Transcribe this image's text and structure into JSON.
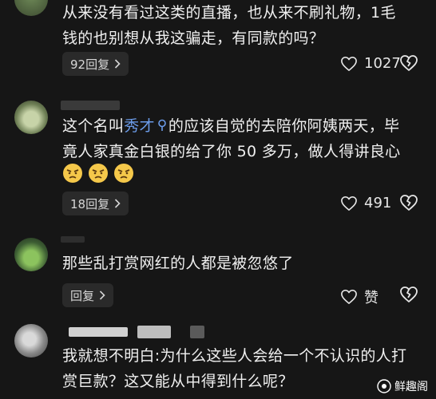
{
  "comments": [
    {
      "lines": [
        "从来没有看过这类的直播，也从来不刷礼物，1毛",
        "钱的也别想从我这骗走，有同款的吗？"
      ],
      "replies_label": "92回复",
      "like_count": "1027"
    },
    {
      "text_before_link": "这个名叫",
      "link_text": "秀才",
      "text_after_link": "的应该自觉的去陪你阿姨两天，毕",
      "line2": "竟人家真金白银的给了你 50 多万，做人得讲良心",
      "emojis": [
        "angry-face-emoji",
        "angry-face-emoji",
        "angry-face-emoji"
      ],
      "replies_label": "18回复",
      "like_count": "491"
    },
    {
      "text": "那些乱打赏网红的人都是被忽悠了",
      "replies_label": "回复",
      "like_label": "赞"
    },
    {
      "lines": [
        "我就想不明白:为什么这些人会给一个不认识的人打",
        "赏巨款？这又能从中得到什么呢？"
      ]
    }
  ],
  "watermark": {
    "text": "鲜趣阁"
  },
  "icons": {
    "heart": "heart-outline-icon",
    "broken_heart": "broken-heart-icon",
    "chevron": "chevron-right-icon",
    "search": "search-icon"
  }
}
